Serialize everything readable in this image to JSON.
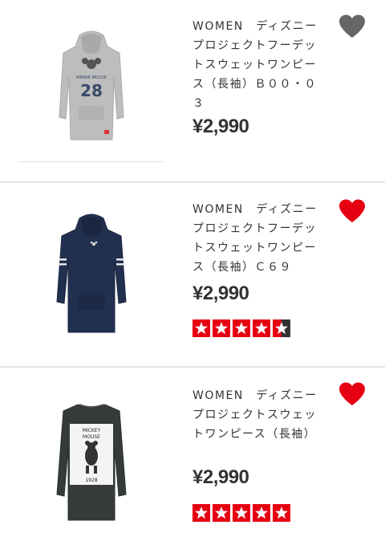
{
  "colors": {
    "accent_red": "#e60012",
    "fav_inactive": "#666666",
    "text": "#333333"
  },
  "products": [
    {
      "title": "WOMEN　ディズニープロジェクトフーデットスウェットワンピース（長袖）Ｂ００・０３",
      "price": "¥2,990",
      "favorite": false,
      "favorite_icon": "heart-icon",
      "rating": null,
      "image_text": "28",
      "image_color": "grey-hoodie-dress"
    },
    {
      "title": "WOMEN　ディズニープロジェクトフーデットスウェットワンピース（長袖）Ｃ６９",
      "price": "¥2,990",
      "favorite": true,
      "favorite_icon": "heart-icon",
      "rating": 4.5,
      "image_color": "navy-hoodie-dress"
    },
    {
      "title": "WOMEN　ディズニープロジェクトスウェットワンピース（長袖）",
      "price": "¥2,990",
      "favorite": true,
      "favorite_icon": "heart-icon",
      "rating": 5,
      "image_text_lines": [
        "MICKEY",
        "MOUSE",
        "1928"
      ],
      "image_color": "charcoal-sweat-dress"
    }
  ]
}
